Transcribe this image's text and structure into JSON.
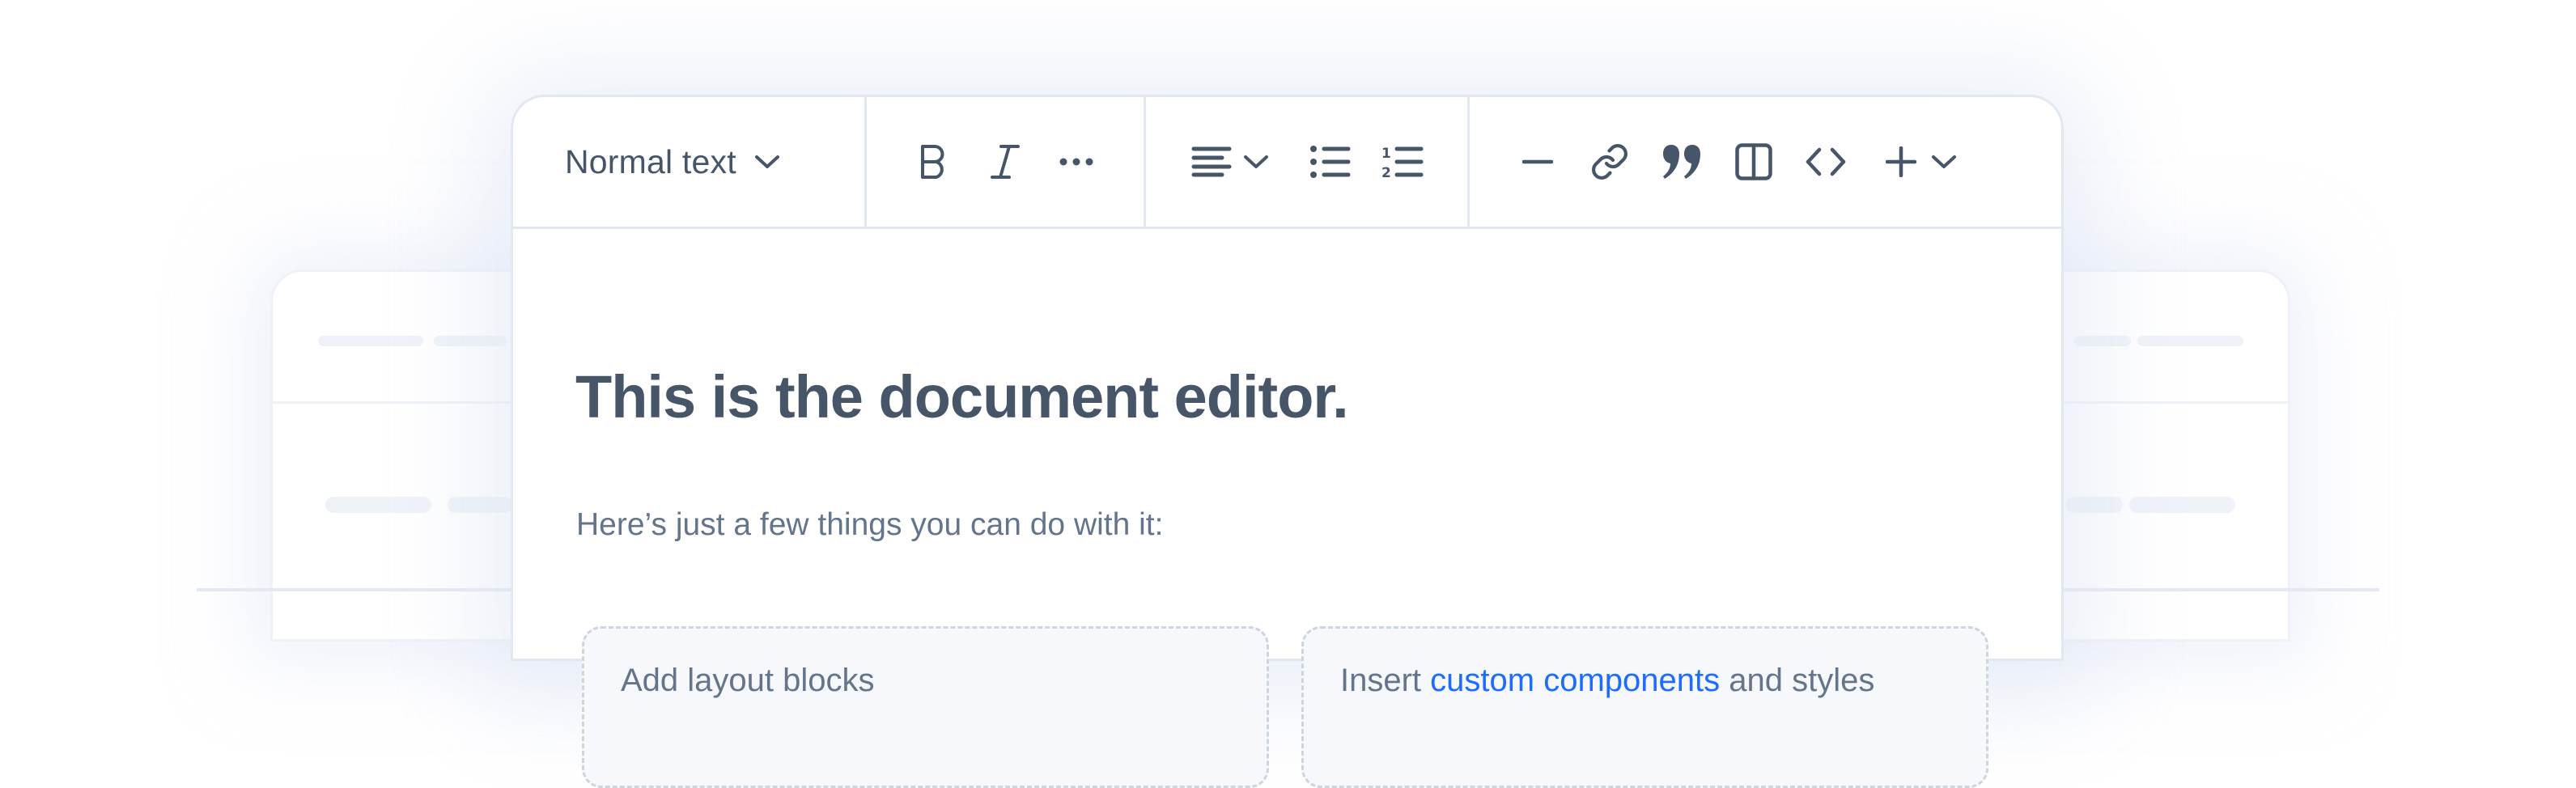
{
  "toolbar": {
    "text_style": {
      "label": "Normal text",
      "icon": "chevron-down-icon"
    },
    "groups": [
      {
        "name": "formatting",
        "buttons": [
          {
            "id": "bold",
            "icon": "bold-icon"
          },
          {
            "id": "italic",
            "icon": "italic-icon"
          },
          {
            "id": "more",
            "icon": "more-horizontal-icon"
          }
        ]
      },
      {
        "name": "paragraph",
        "buttons": [
          {
            "id": "align",
            "icon": "align-left-icon",
            "dropdown": true
          },
          {
            "id": "bullet-list",
            "icon": "bullet-list-icon"
          },
          {
            "id": "ordered-list",
            "icon": "ordered-list-icon"
          }
        ]
      },
      {
        "name": "insert",
        "buttons": [
          {
            "id": "horizontal-rule",
            "icon": "minus-icon"
          },
          {
            "id": "link",
            "icon": "link-icon"
          },
          {
            "id": "quote",
            "icon": "quote-icon"
          },
          {
            "id": "columns",
            "icon": "columns-icon"
          },
          {
            "id": "code",
            "icon": "code-icon"
          },
          {
            "id": "insert-more",
            "icon": "plus-icon",
            "dropdown": true
          }
        ]
      }
    ]
  },
  "document": {
    "title": "This is the document editor.",
    "subtitle": "Here’s just a few things you can do with it:",
    "blocks": [
      {
        "text": "Add layout blocks"
      },
      {
        "prefix": "Insert ",
        "link": "custom components",
        "suffix": " and styles"
      }
    ]
  },
  "colors": {
    "text": "#475569",
    "muted_text": "#64748b",
    "link": "#1e6bff",
    "border": "#e2e8f0",
    "block_bg": "#f6f8fb"
  }
}
